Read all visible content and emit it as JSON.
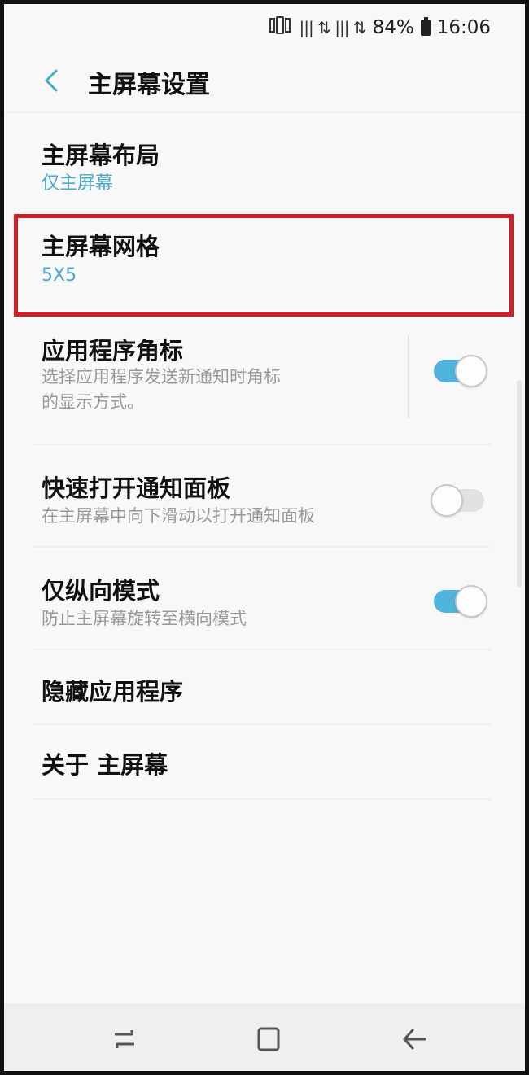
{
  "status_bar": {
    "signal_glyph": "||| ⇅ ||| ⇅",
    "battery_percent": "84%",
    "time": "16:06"
  },
  "header": {
    "title": "主屏幕设置"
  },
  "settings": [
    {
      "title": "主屏幕布局",
      "subtitle": "仅主屏幕"
    },
    {
      "title": "主屏幕网格",
      "subtitle": "5X5",
      "highlighted": true
    },
    {
      "title": "应用程序角标",
      "subtitle_line1": "选择应用程序发送新通知时角标",
      "subtitle_line2": "的显示方式。",
      "toggle_on": true
    },
    {
      "title": "快速打开通知面板",
      "subtitle": "在主屏幕中向下滑动以打开通知面板",
      "toggle_on": false
    },
    {
      "title": "仅纵向模式",
      "subtitle": "防止主屏幕旋转至横向模式",
      "toggle_on": true
    },
    {
      "title": "隐藏应用程序"
    },
    {
      "title": "关于 主屏幕"
    }
  ],
  "colors": {
    "accent": "#4aa9c8",
    "toggle_on": "#4fb3dc",
    "highlight_border": "#d41e26"
  },
  "navbar": {
    "icons": [
      "recent-apps-icon",
      "home-icon",
      "back-arrow-icon"
    ]
  }
}
